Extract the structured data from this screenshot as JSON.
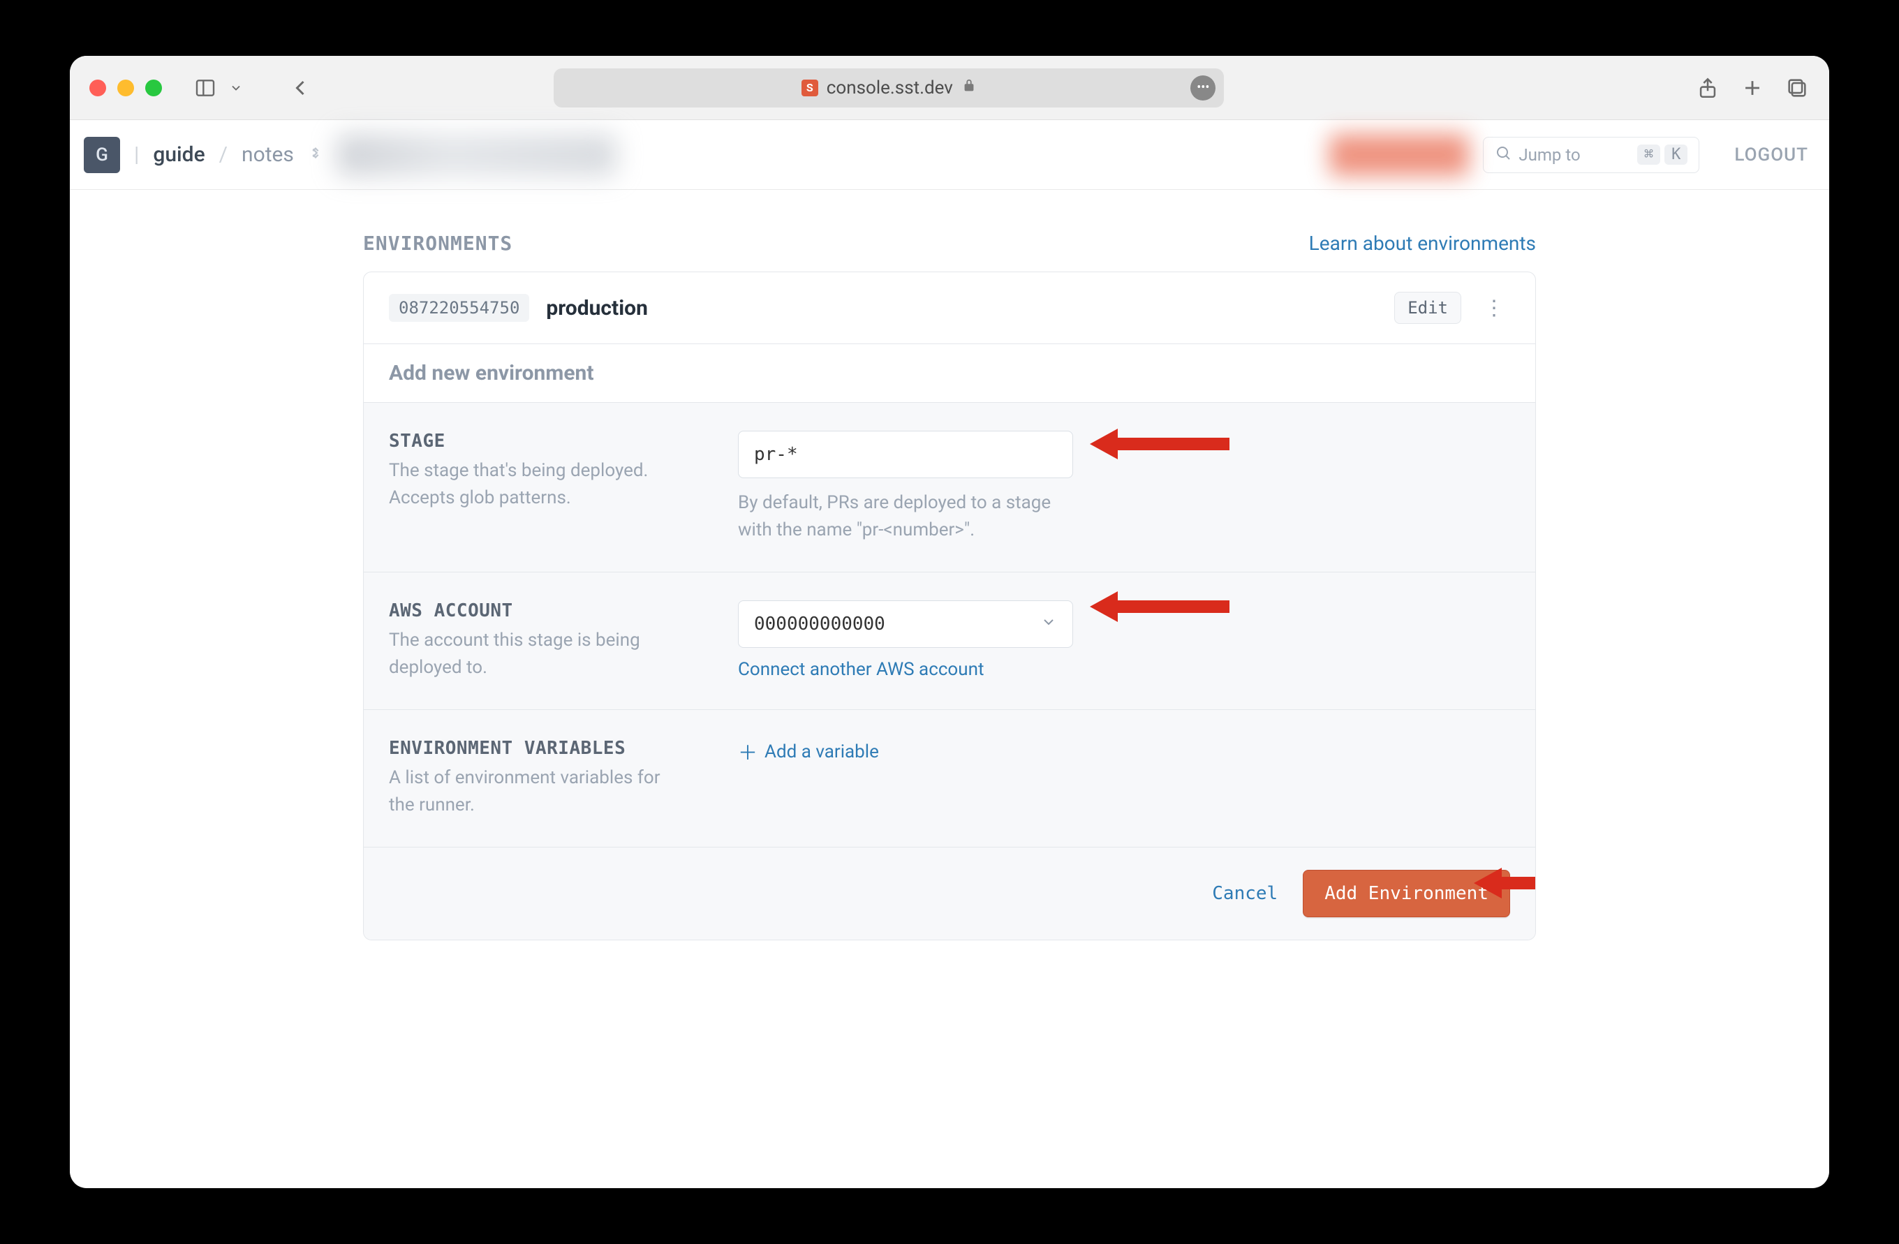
{
  "browser": {
    "url": "console.sst.dev"
  },
  "header": {
    "avatar_letter": "G",
    "crumb1": "guide",
    "crumb2": "notes",
    "jump_placeholder": "Jump to",
    "kbd1": "⌘",
    "kbd2": "K",
    "logout": "LOGOUT"
  },
  "page": {
    "section_title": "ENVIRONMENTS",
    "learn_link": "Learn about environments",
    "existing_env": {
      "account_id": "087220554750",
      "name": "production",
      "edit_label": "Edit"
    },
    "add_row_title": "Add new environment",
    "stage": {
      "label": "STAGE",
      "desc": "The stage that's being deployed. Accepts glob patterns.",
      "value": "pr-*",
      "hint": "By default, PRs are deployed to a stage with the name \"pr-<number>\"."
    },
    "aws": {
      "label": "AWS ACCOUNT",
      "desc": "The account this stage is being deployed to.",
      "value": "000000000000",
      "connect_link": "Connect another AWS account"
    },
    "envvars": {
      "label": "ENVIRONMENT VARIABLES",
      "desc": "A list of environment variables for the runner.",
      "add_link": "Add a variable"
    },
    "footer": {
      "cancel": "Cancel",
      "submit": "Add Environment"
    }
  }
}
